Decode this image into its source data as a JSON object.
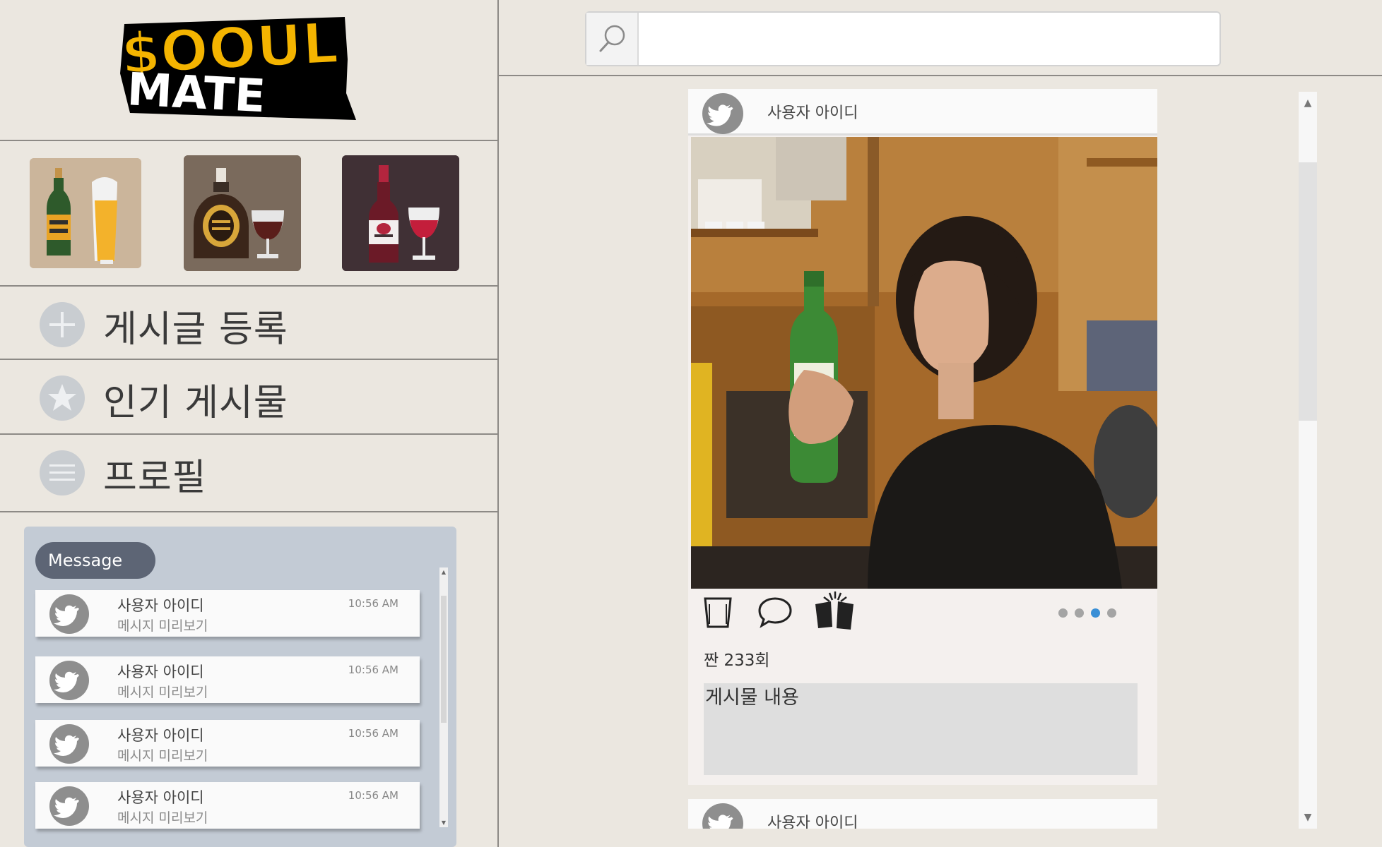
{
  "app": {
    "logo_text_top": "$OOUL",
    "logo_text_bottom": "MATE",
    "accent_blue": "#3a8fd6",
    "panel_color": "#c3cbd5"
  },
  "categories": [
    {
      "name": "beer",
      "icon": "beer-bottle-and-glass-icon"
    },
    {
      "name": "whiskey",
      "icon": "whiskey-bottle-and-glass-icon"
    },
    {
      "name": "wine",
      "icon": "wine-bottle-and-glass-icon"
    }
  ],
  "nav": {
    "items": [
      {
        "label": "게시글 등록",
        "icon": "plus-icon"
      },
      {
        "label": "인기 게시물",
        "icon": "star-icon"
      },
      {
        "label": "프로필",
        "icon": "menu-icon"
      }
    ]
  },
  "messages": {
    "title": "Message",
    "items": [
      {
        "name": "사용자 아이디",
        "preview": "메시지 미리보기",
        "time": "10:56 AM"
      },
      {
        "name": "사용자 아이디",
        "preview": "메시지 미리보기",
        "time": "10:56 AM"
      },
      {
        "name": "사용자 아이디",
        "preview": "메시지 미리보기",
        "time": "10:56 AM"
      },
      {
        "name": "사용자 아이디",
        "preview": "메시지 미리보기",
        "time": "10:56 AM"
      }
    ]
  },
  "search": {
    "placeholder": "",
    "value": ""
  },
  "feed": {
    "posts": [
      {
        "user": "사용자 아이디",
        "likes": "짠 233회",
        "content": "게시물 내용",
        "photo": "photo of a woman drinking from a green soju bottle",
        "carousel": {
          "count": 4,
          "active": 3
        }
      },
      {
        "user": "사용자 아이디"
      }
    ]
  }
}
